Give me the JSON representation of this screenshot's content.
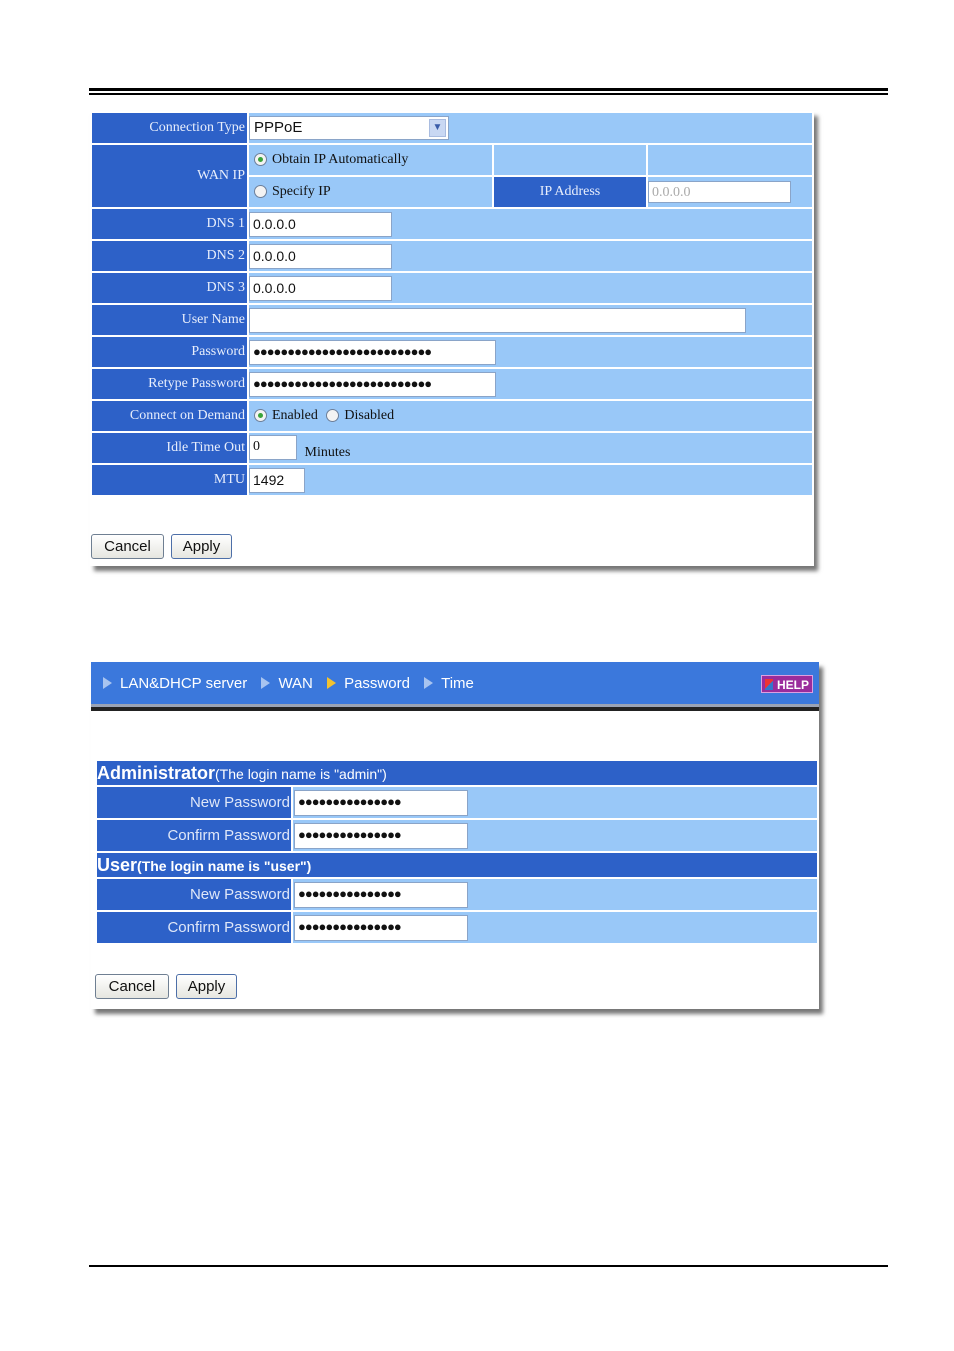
{
  "wan_form": {
    "connection_type": {
      "label": "Connection Type",
      "selected": "PPPoE"
    },
    "wan_ip": {
      "label": "WAN IP",
      "options": [
        {
          "label": "Obtain IP Automatically",
          "checked": true
        },
        {
          "label": "Specify IP",
          "checked": false
        }
      ],
      "ip_address_label": "IP Address",
      "ip_address_value": "0.0.0.0"
    },
    "dns1": {
      "label": "DNS 1",
      "value": "0.0.0.0"
    },
    "dns2": {
      "label": "DNS 2",
      "value": "0.0.0.0"
    },
    "dns3": {
      "label": "DNS 3",
      "value": "0.0.0.0"
    },
    "user_name": {
      "label": "User Name",
      "value": ""
    },
    "password": {
      "label": "Password",
      "masked": "●●●●●●●●●●●●●●●●●●●●●●●●●●"
    },
    "retype_password": {
      "label": "Retype Password",
      "masked": "●●●●●●●●●●●●●●●●●●●●●●●●●●"
    },
    "connect_on_demand": {
      "label": "Connect on Demand",
      "options": [
        {
          "label": "Enabled",
          "checked": true
        },
        {
          "label": "Disabled",
          "checked": false
        }
      ]
    },
    "idle_time_out": {
      "label": "Idle Time Out",
      "value": "0",
      "unit": "Minutes"
    },
    "mtu": {
      "label": "MTU",
      "value": "1492"
    },
    "buttons": {
      "cancel": "Cancel",
      "apply": "Apply"
    }
  },
  "password_form": {
    "nav": {
      "items": [
        "LAN&DHCP server",
        "WAN",
        "Password",
        "Time"
      ],
      "active": "Password",
      "help": "HELP"
    },
    "administrator": {
      "title": "Administrator",
      "note": "(The login name is \"admin\")",
      "new_password_label": "New Password",
      "new_password_masked": "●●●●●●●●●●●●●●●",
      "confirm_password_label": "Confirm Password",
      "confirm_password_masked": "●●●●●●●●●●●●●●●"
    },
    "user": {
      "title": "User",
      "note": "(The login name is \"user\")",
      "new_password_label": "New Password",
      "new_password_masked": "●●●●●●●●●●●●●●●",
      "confirm_password_label": "Confirm Password",
      "confirm_password_masked": "●●●●●●●●●●●●●●●"
    },
    "buttons": {
      "cancel": "Cancel",
      "apply": "Apply"
    }
  },
  "colors": {
    "label_bg": "#2d61c8",
    "value_bg": "#99c8f8",
    "nav_bg": "#3b78dc",
    "help_bg": "#9a2c9c"
  }
}
